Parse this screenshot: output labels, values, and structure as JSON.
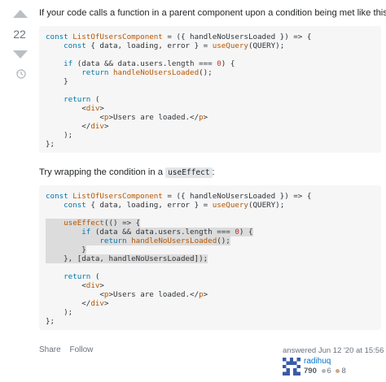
{
  "vote": {
    "score": "22"
  },
  "answer": {
    "intro": "If your code calls a function in a parent component upon a condition being met like this:",
    "try_before": "Try wrapping the condition in a ",
    "try_code": "useEffect",
    "try_after": ":"
  },
  "code1": [
    [
      [
        "k",
        "const "
      ],
      [
        "f",
        "ListOfUsersComponent"
      ],
      [
        "t",
        " = ({ handleNoUsersLoaded }) => {"
      ]
    ],
    [
      [
        "t",
        "    "
      ],
      [
        "k",
        "const"
      ],
      [
        "t",
        " { data, loading, error } = "
      ],
      [
        "f",
        "useQuery"
      ],
      [
        "t",
        "(QUERY);"
      ]
    ],
    [],
    [
      [
        "t",
        "    "
      ],
      [
        "k",
        "if"
      ],
      [
        "t",
        " (data && data.users.length === "
      ],
      [
        "s",
        "0"
      ],
      [
        "t",
        ") {"
      ]
    ],
    [
      [
        "t",
        "        "
      ],
      [
        "k",
        "return "
      ],
      [
        "f",
        "handleNoUsersLoaded"
      ],
      [
        "t",
        "();"
      ]
    ],
    [
      [
        "t",
        "    }"
      ]
    ],
    [],
    [
      [
        "t",
        "    "
      ],
      [
        "k",
        "return"
      ],
      [
        "t",
        " ("
      ]
    ],
    [
      [
        "t",
        "        <"
      ],
      [
        "f",
        "div"
      ],
      [
        "t",
        ">"
      ]
    ],
    [
      [
        "t",
        "            <"
      ],
      [
        "f",
        "p"
      ],
      [
        "t",
        ">Users are loaded.</"
      ],
      [
        "f",
        "p"
      ],
      [
        "t",
        ">"
      ]
    ],
    [
      [
        "t",
        "        </"
      ],
      [
        "f",
        "div"
      ],
      [
        "t",
        ">"
      ]
    ],
    [
      [
        "t",
        "    );"
      ]
    ],
    [
      [
        "t",
        "};"
      ]
    ]
  ],
  "code2": [
    [
      [
        "k",
        "const "
      ],
      [
        "f",
        "ListOfUsersComponent"
      ],
      [
        "t",
        " = ({ handleNoUsersLoaded }) => {"
      ]
    ],
    [
      [
        "t",
        "    "
      ],
      [
        "k",
        "const"
      ],
      [
        "t",
        " { data, loading, error } = "
      ],
      [
        "f",
        "useQuery"
      ],
      [
        "t",
        "(QUERY);"
      ]
    ],
    [],
    [
      [
        "t",
        "    "
      ],
      [
        "f",
        "useEffect"
      ],
      [
        "t",
        "(() => {"
      ]
    ],
    [
      [
        "t",
        "        "
      ],
      [
        "k",
        "if"
      ],
      [
        "t",
        " (data && data.users.length === "
      ],
      [
        "s",
        "0"
      ],
      [
        "t",
        ") {"
      ]
    ],
    [
      [
        "t",
        "            "
      ],
      [
        "k",
        "return "
      ],
      [
        "f",
        "handleNoUsersLoaded"
      ],
      [
        "t",
        "();"
      ]
    ],
    [
      [
        "t",
        "        }"
      ]
    ],
    [
      [
        "t",
        "    }, [data, handleNoUsersLoaded]);"
      ]
    ],
    [],
    [
      [
        "t",
        "    "
      ],
      [
        "k",
        "return"
      ],
      [
        "t",
        " ("
      ]
    ],
    [
      [
        "t",
        "        <"
      ],
      [
        "f",
        "div"
      ],
      [
        "t",
        ">"
      ]
    ],
    [
      [
        "t",
        "            <"
      ],
      [
        "f",
        "p"
      ],
      [
        "t",
        ">Users are loaded.</"
      ],
      [
        "f",
        "p"
      ],
      [
        "t",
        ">"
      ]
    ],
    [
      [
        "t",
        "        </"
      ],
      [
        "f",
        "div"
      ],
      [
        "t",
        ">"
      ]
    ],
    [
      [
        "t",
        "    );"
      ]
    ],
    [
      [
        "t",
        "};"
      ]
    ]
  ],
  "code2_highlight_lines": [
    3,
    4,
    5,
    6,
    7
  ],
  "post_menu": {
    "share": "Share",
    "follow": "Follow"
  },
  "user_card": {
    "action": "answered Jun 12 '20 at 15:56",
    "name": "radihuq",
    "reputation": "790",
    "silver_badges": "6",
    "bronze_badges": "8",
    "silver_color": "#b4b8bc",
    "bronze_color": "#d1a684"
  },
  "icons": [
    "upvote-icon",
    "downvote-icon",
    "history-icon",
    "identicon-avatar"
  ]
}
